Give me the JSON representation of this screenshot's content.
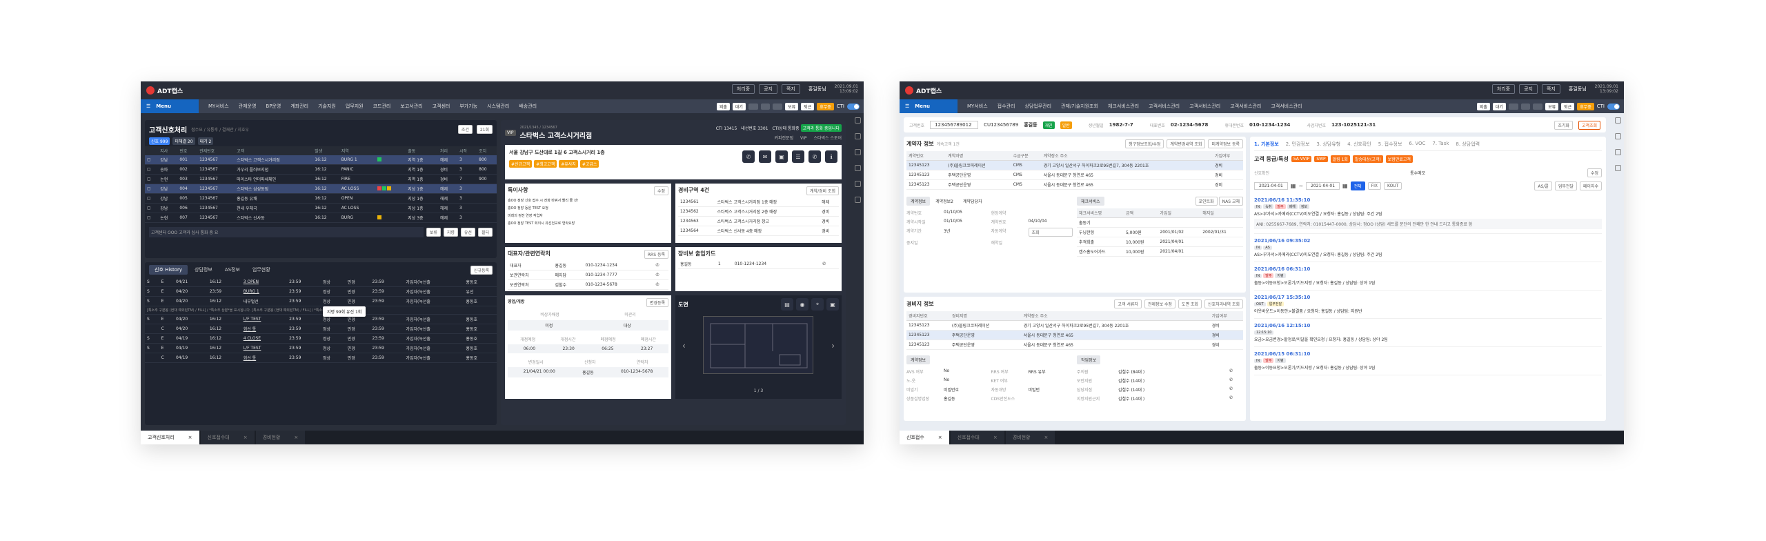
{
  "app": {
    "brand": "ADT캡스",
    "header_buttons": [
      "처리중",
      "공지",
      "쪽지"
    ],
    "user": "홍길동님",
    "datetime": [
      "2021.09.01",
      "13:09:02"
    ]
  },
  "w1": {
    "menu": {
      "label": "Menu",
      "items": [
        "MY서비스",
        "관제운영",
        "BP운영",
        "계좌관리",
        "기술지원",
        "업무지원",
        "코드관리",
        "보고서관리",
        "고객센터",
        "부가기능",
        "시스템관리",
        "배송관리",
        "CRM"
      ],
      "right": [
        "외출",
        "대기",
        "",
        "",
        "",
        "",
        "보류",
        "퇴근",
        "휴무중",
        "CTI"
      ]
    },
    "list": {
      "title": "고객신호처리",
      "breadcrumb": "접수요 / 유통후 / 결재관 / 지호우",
      "btn_search": "조건",
      "btn_refresh": "21회",
      "toggles": [
        {
          "label": "신호 999"
        },
        {
          "label": "미해결 20"
        },
        {
          "label": "대기 2"
        }
      ],
      "headers": [
        "",
        "지사",
        "번호",
        "관제번호",
        "고객",
        "",
        "발생",
        "지역",
        "출동",
        "처리",
        "",
        "시작",
        "조치",
        "확인"
      ],
      "rows": [
        [
          "강남",
          "001",
          "1234567",
          "스타벅스 고객스시거리점",
          "16:12",
          "BURG 1",
          "",
          "지역 1층",
          "해제",
          "3",
          "800"
        ],
        [
          "송파",
          "002",
          "1234567",
          "가우리 플러브지점",
          "16:12",
          "PANIC",
          "",
          "지역 1층",
          "경비",
          "3",
          "800"
        ],
        [
          "논현",
          "003",
          "1234567",
          "마이스타 언더파쇄체인",
          "16:12",
          "FIRE",
          "",
          "지역 1층",
          "경비",
          "7",
          "900"
        ],
        [
          "강남",
          "004",
          "1234567",
          "스타벅스 삼성동점",
          "16:12",
          "AC LOSS",
          "",
          "지상 1층",
          "해제",
          "3",
          ""
        ],
        [
          "강남",
          "005",
          "1234567",
          "홍길동 유쾌",
          "16:12",
          "OPEN",
          "",
          "지상 1층",
          "해제",
          "3",
          ""
        ],
        [
          "강남",
          "006",
          "1234567",
          "천내 우체국",
          "16:12",
          "AC LOSS",
          "",
          "지상 1층",
          "해제",
          "3",
          ""
        ],
        [
          "논현",
          "007",
          "1234567",
          "스타벅스 신사동",
          "16:12",
          "BURG",
          "",
          "지상 3층",
          "해제",
          "3",
          ""
        ]
      ],
      "note": "고객센터 OOO 고객과 심사 통화 중 요",
      "footer_btns": [
        "보류",
        "지령",
        "유선",
        "필터"
      ]
    },
    "history": {
      "tabs": [
        "신호 History",
        "상담정보",
        "AS정보",
        "업무현황"
      ],
      "btn": "신규등록",
      "rows": [
        [
          "S",
          "E",
          "04/21",
          "16:12",
          "3 OPEN",
          "23:59",
          "정상",
          "민경",
          "23:59",
          "가입자(녹선출",
          "홍동호"
        ],
        [
          "S",
          "E",
          "04/20",
          "23:59",
          "BURG 1",
          "23:59",
          "정상",
          "민경",
          "23:59",
          "가입자(녹선출",
          "유선"
        ],
        [
          "S",
          "E",
          "04/20",
          "16:12",
          "내부멀선",
          "23:59",
          "정상",
          "민경",
          "23:59",
          "가입자(녹선출",
          "홍동호"
        ],
        [
          "S",
          "E",
          "04/20",
          "16:12",
          "L/F TEST",
          "23:59",
          "정상",
          "민경",
          "23:59",
          "가입자(녹선출",
          "홍동호"
        ],
        [
          "",
          "C",
          "04/20",
          "16:12",
          "회선 통",
          "23:59",
          "정상",
          "민경",
          "23:59",
          "가입자(녹선출",
          "홍동호"
        ],
        [
          "S",
          "E",
          "04/19",
          "16:12",
          "4 CLOSE",
          "23:59",
          "정상",
          "민경",
          "23:59",
          "가입자(녹선출",
          "홍동호"
        ],
        [
          "S",
          "E",
          "04/19",
          "16:12",
          "L/F TEST",
          "23:59",
          "정상",
          "민경",
          "23:59",
          "가입자(녹선출",
          "홍동호"
        ],
        [
          "",
          "C",
          "04/19",
          "16:12",
          "회선 통",
          "23:59",
          "정상",
          "민경",
          "23:59",
          "가입자(녹선출",
          "홍동호"
        ]
      ],
      "remark": "[특소주 구분봉 (현재 예외된TM) / FILL] / *특소주 상분*을 표시됩니다. [특소주 구분봉 (현재 예외된TM) / FILL] / *특소주 상분*을 표시됩니다.",
      "tooltip1": "내부멀선",
      "tooltip2": "지령 99회 유선 1회"
    },
    "detail": {
      "id": "2021/1345 / 1234567",
      "name": "스타벅스 고객스시거리점",
      "cti": "CTI 13415",
      "ext": "내선번호 3301",
      "cti2": "CTI상태 통화중",
      "notice": "고객과 통화 중입니다",
      "sub": [
        "커피전문점",
        "VIP",
        "스타벅스 스토어"
      ],
      "address": "서울 강남구 도산대로 1길 6 고객스시거리 1층",
      "tags": [
        "#신규고객",
        "#최고고객",
        "#유사지",
        "#고급스"
      ],
      "call_btns": [
        "전화",
        "문자",
        "영상",
        "SMS",
        "모바일",
        "정보"
      ],
      "special": {
        "title": "특이사항",
        "btn": "수정",
        "items": [
          "홍OO 정장 신호 접수 시 전화 바꿔서 빨리 줄 것!",
          "홍OO 정장 동원 TEST 요청",
          "미래의 정전 연장 작업자",
          "홍OO 정장 TEST 회의시 유선전교로 연락요망"
        ]
      },
      "history2": {
        "title": "경비구역 4건",
        "btn": "계약/경비 조회",
        "items": [
          [
            "1234561",
            "스타벅스 고객스시거리점 1층 매장",
            "해제"
          ],
          [
            "1234562",
            "스타벅스 고객스시거리점 2층 매장",
            "경비"
          ],
          [
            "1234563",
            "스타벅스 고객스시거리점 창고",
            "경비"
          ],
          [
            "1234564",
            "스타벅스 신사동 4층 매장",
            "경비"
          ]
        ]
      },
      "contacts": {
        "title": "대표자/관련연락처",
        "btn": "RRS 등록",
        "rows": [
          [
            "대표자",
            "홍길동",
            "010-1234-1234"
          ],
          [
            "보관연락처",
            "메지담",
            "010-1234-7777"
          ],
          [
            "보관연락처",
            "김할수",
            "010-1234-5678"
          ]
        ]
      },
      "keys": {
        "title": "장비보 출입카드",
        "rows": [
          [
            "홍길동",
            "1",
            "010-1234-1234"
          ]
        ]
      },
      "hours": {
        "title": "영업/개방",
        "btn": "변경등록",
        "a": "비상가배정",
        "b": "미관리",
        "a_v": "미정",
        "b_v": "대상",
        "heads": [
          "개점예정",
          "개점시간",
          "폐점예정",
          "폐점시간"
        ],
        "vals": [
          "06:00",
          "23:30",
          "06:25",
          "23:27"
        ],
        "h2": [
          "변경일시",
          "신청자",
          "연락처"
        ],
        "v2": [
          "21/04/21 00:00",
          "홍길동",
          "010-1234-5678"
        ]
      },
      "floor": {
        "title": "도면",
        "page": "1 / 3"
      }
    },
    "bottom_tabs": [
      "고객신호처리",
      "신호접수대",
      "경비현황"
    ]
  },
  "w2": {
    "menu": {
      "label": "Menu",
      "items": [
        "MY서비스",
        "접수관리",
        "상담업무관리",
        "관제/기술지원조회",
        "체크서비스관리",
        "고객서비스관리",
        "고객서비스관리",
        "고객서비스관리",
        "고객서비스관리"
      ],
      "right": [
        "외출",
        "대기",
        "",
        "",
        "",
        "",
        "보류",
        "퇴근",
        "휴무중",
        "CTI"
      ]
    },
    "search": {
      "label": "고객번호",
      "value": "123456789012",
      "cu": "CU123456789",
      "name": "홍길동",
      "badge1": "개인",
      "badge2": "일반",
      "birth_label": "생년월일",
      "birth": "1982-7-7",
      "rep_label": "대표번호",
      "rep": "02-1234-5678",
      "mobile_label": "휴대폰번호",
      "mobile": "010-1234-1234",
      "biz_label": "사업자번호",
      "biz": "123-1025121-31",
      "btn1": "조기화",
      "btn2": "고객조회"
    },
    "contract": {
      "title": "계약자 정보",
      "sub": "계속고객 1건",
      "btns": [
        "청구정보조회/수정",
        "계약변경내역 조회",
        "미계약정보 등록"
      ],
      "headers": [
        "계약번호",
        "계약자명",
        "수금구분",
        "계약장소 주소",
        "가입여부"
      ],
      "rows": [
        [
          "12345123",
          "(주)블링크코퍼레이션",
          "CMS",
          "경기 고양시 일산서구 하이파크2로95번길7, 304동 2201호",
          "경비"
        ],
        [
          "12345123",
          "주택공단운영",
          "CMS",
          "서울시 동대문구 청연로 465",
          "경비"
        ],
        [
          "12345123",
          "주택공단운영",
          "CMS",
          "서울시 동대문구 청연로 465",
          "경비"
        ]
      ],
      "tabs": [
        "계약정보",
        "계약정보2",
        "계약담당자"
      ],
      "fields": [
        [
          "계약번호",
          "01/10/05",
          "현장계약",
          ""
        ],
        [
          "계약시작일",
          "01/10/05",
          "계약번호",
          "04/10/04"
        ],
        [
          "계약기간",
          "3년",
          "자동계약",
          "조회"
        ],
        [
          "중지일",
          "",
          "해약일",
          ""
        ]
      ],
      "svc_title": "체크서비스",
      "svc_btns": [
        "포인트화",
        "NAS 교체"
      ],
      "svc_headers": [
        "체크서비스명",
        "금액",
        "가입일",
        "해지일"
      ],
      "svc_rows": [
        [
          "출동기",
          "",
          "",
          ""
        ],
        [
          "두닝한형",
          "5,000원",
          "2001/01/02",
          "2002/01/31"
        ],
        [
          "추격회출",
          "10,000원",
          "2021/04/01",
          ""
        ],
        [
          "캡스홈도어가드",
          "10,000원",
          "2021/04/01",
          ""
        ]
      ]
    },
    "guard": {
      "title": "경비지 정보",
      "btns": [
        "고객 서류자",
        "관제정보 수정",
        "도면 조회",
        "신호처리내역 조회"
      ],
      "headers": [
        "경비지번호",
        "경비지명",
        "계약장소 주소",
        "가입여부"
      ],
      "rows": [
        [
          "12345123",
          "(주)블링크코퍼레이션",
          "경기 고양시 일산서구 하이파크2로95번길7, 304동 2201호",
          "경비"
        ],
        [
          "12345123",
          "주택공단운영",
          "서울시 동대문구 청연로 465",
          "경비"
        ],
        [
          "12345123",
          "주택공단운영",
          "서울시 동대문구 청연로 465",
          "경비"
        ]
      ],
      "tab1": "계약정보",
      "tab2": "작업정보",
      "f1": [
        [
          "AVS 여부",
          "No",
          "RRS 여부",
          "RRS 유부"
        ],
        [
          "노-웃",
          "No",
          "KET 여부",
          ""
        ],
        [
          "비밀기",
          "비밀번호",
          "자동개방",
          "비밀번"
        ],
        [
          "상품설명업장",
          "홍길동",
          "CDS안전도스",
          ""
        ]
      ],
      "f2": [
        [
          "주의원",
          "김철수 (84대 )"
        ],
        [
          "보안지원",
          "김철수 (14대 )"
        ],
        [
          "담당지점",
          "김철수 (14대 )"
        ],
        [
          "지방지원근지",
          "김철수 (14대 )"
        ]
      ]
    },
    "right": {
      "tabs": [
        "1. 기본정보",
        "2. 민감정보",
        "3. 상담유형",
        "4. 신호확인",
        "5. 접수정보",
        "6. VOC",
        "7. Task",
        "8. 상담업력"
      ],
      "grade_title": "고객 등급/특성",
      "grades": [
        "5A VVIP",
        "SWP",
        "알림 1회",
        "발송대상(고객)",
        "보험만료고객"
      ],
      "signal_label": "신호확인",
      "signal_col": "통수메모",
      "btn_edit": "수정",
      "date_from": "2021-04-01",
      "date_to": "2021-04-01",
      "filters": [
        "전체",
        "FIX",
        "KOUT"
      ],
      "btns": [
        "AS/콜",
        "업무전달",
        "페이지수"
      ],
      "timeline": [
        {
          "time": "2021/06/16 11:35:10",
          "tags": [
            "IN",
            "녹취",
            "발주",
            "배해",
            "정보"
          ],
          "text": "AS>부가서>카메라(CCTV)미도연결 / 요청자: 홍길동 / 상담팀: 주간 2팀",
          "detail": "ANI: 0255667-7689, 연락처: 01015447-0000, 상담사: 정OO (상담) 세트를 분단의 전쾌만 한 안내 드리고 통화종료 함"
        },
        {
          "time": "2021/06/16 09:35:02",
          "tags": [
            "IN",
            "AS"
          ],
          "text": "AS>부가서>카메라(CCTV)미도연결 / 요청자: 홍길동 / 상담팀: 주간 2팀",
          "detail": ""
        },
        {
          "time": "2021/06/16 06:31:10",
          "tags": [
            "IN",
            "발주",
            "지령"
          ],
          "text": "출동>이동요청>오론기/키드지령 / 요청자: 홍길동 / 상담팀: 상야 1팀",
          "detail": ""
        },
        {
          "time": "2021/06/17 15:35:10",
          "tags": [
            "OUT",
            "업무전달"
          ],
          "text": "아웃바운드>이동안>불결품 / 요청자: 홍길동 / 상담팀: 지원반",
          "detail": ""
        },
        {
          "time": "2021/06/16 12:15:10",
          "tags": [
            "12:15:10"
          ],
          "text": "요금>요금변경>할정로/이달을 확인요청 / 요청자: 홍길동 / 상담팀: 상야 2팀",
          "detail": ""
        },
        {
          "time": "2021/06/15 06:31:10",
          "tags": [
            "IN",
            "발주",
            "지령"
          ],
          "text": "출동>이동요청>오론기/키드지령 / 요청자: 홍길동 / 상담팀: 상야 1팀",
          "detail": ""
        }
      ]
    },
    "bottom_tabs": [
      "신호접수",
      "신호접수대",
      "경비현황"
    ]
  }
}
